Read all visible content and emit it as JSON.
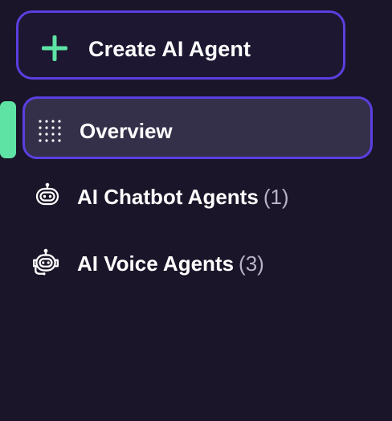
{
  "create_button": {
    "label": "Create AI Agent",
    "icon": "plus-icon"
  },
  "nav": {
    "items": [
      {
        "label": "Overview",
        "count": "",
        "icon": "grid-dots-icon",
        "active": true
      },
      {
        "label": "AI Chatbot Agents",
        "count": "(1)",
        "icon": "robot-icon",
        "active": false
      },
      {
        "label": "AI Voice Agents",
        "count": "(3)",
        "icon": "robot-headset-icon",
        "active": false
      }
    ]
  },
  "colors": {
    "background": "#1b1529",
    "accent_border": "#5b3fe0",
    "active_indicator": "#5fe3a5",
    "active_item_bg": "#35304a",
    "plus_icon": "#5fe3a5",
    "count_text": "#b8b3c8"
  }
}
